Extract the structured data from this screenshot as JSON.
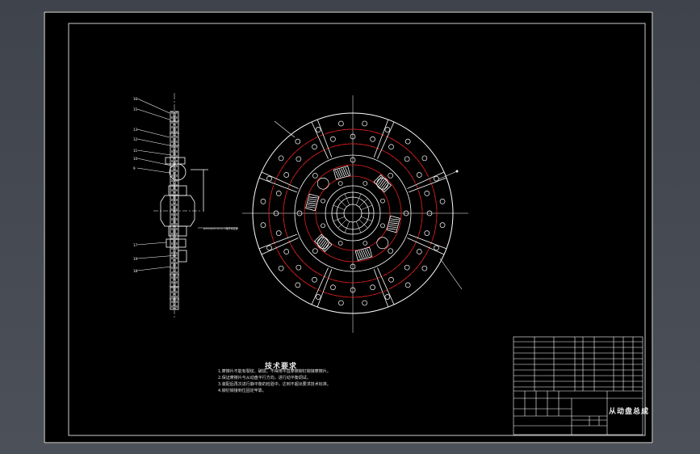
{
  "colors": {
    "sheet_background": "#000000",
    "outline": "#ffffff",
    "hidden_lines": "#e02020",
    "leader_lines": "#ffffff"
  },
  "technical_requirements": {
    "title": "技术要求",
    "items": [
      "1.摩擦片不能有裂纹、破损，不得用平直摩擦铆钉铆接摩擦片。",
      "2.保证摩擦片与从动盘平行方向，进行动平衡调试。",
      "3.装配后再次进行静平衡的检验中，达到不超出要求技术标准。",
      "4.铆钉铆接到位固定牢靠。"
    ]
  },
  "title_block": {
    "drawing_title": "从动盘总成"
  }
}
